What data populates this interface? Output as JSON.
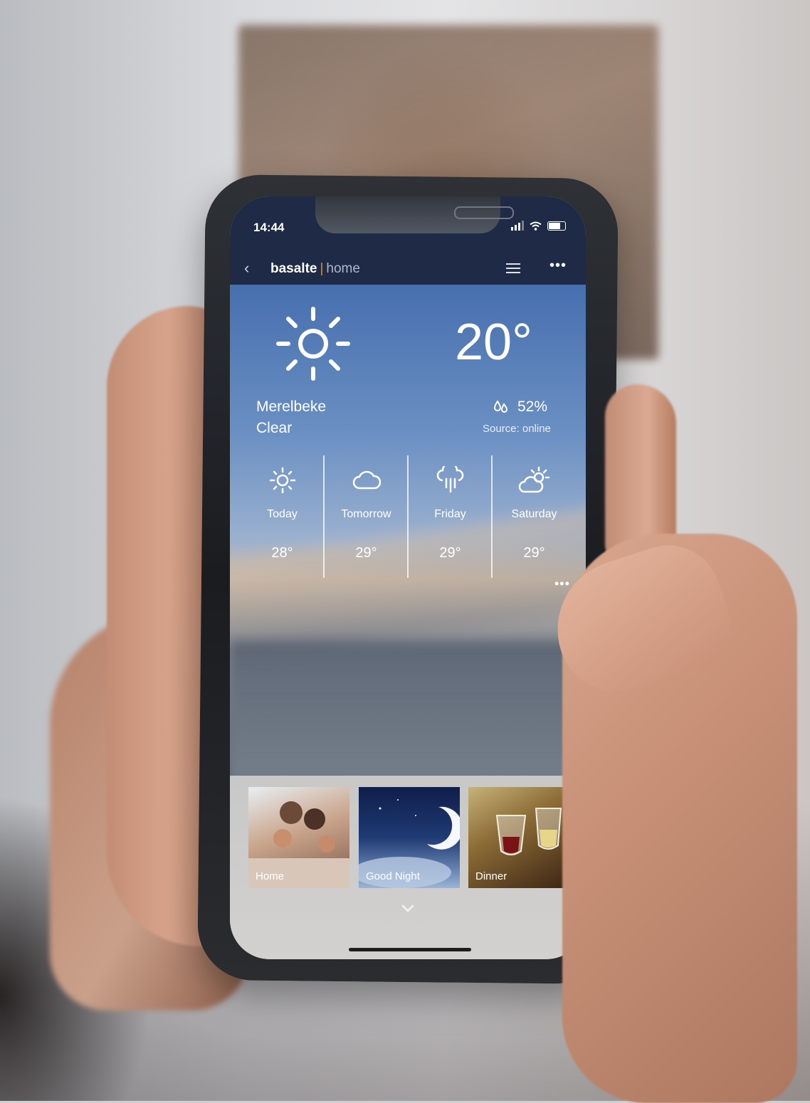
{
  "status": {
    "time": "14:44"
  },
  "nav": {
    "brand": "basalte",
    "separator": "|",
    "section": "home"
  },
  "weather": {
    "temperature": "20°",
    "city": "Merelbeke",
    "condition": "Clear",
    "humidity": "52%",
    "source": "Source: online"
  },
  "forecast": [
    {
      "name": "Today",
      "temp": "28°",
      "icon": "sun-icon"
    },
    {
      "name": "Tomorrow",
      "temp": "29°",
      "icon": "cloud-icon"
    },
    {
      "name": "Friday",
      "temp": "29°",
      "icon": "rain-icon"
    },
    {
      "name": "Saturday",
      "temp": "29°",
      "icon": "partly-cloudy-icon"
    }
  ],
  "scenes": [
    {
      "label": "Home"
    },
    {
      "label": "Good Night"
    },
    {
      "label": "Dinner"
    }
  ],
  "colors": {
    "navbar": "#1e2a46",
    "brand_accent": "#e08a35",
    "sky": "#476fae"
  }
}
